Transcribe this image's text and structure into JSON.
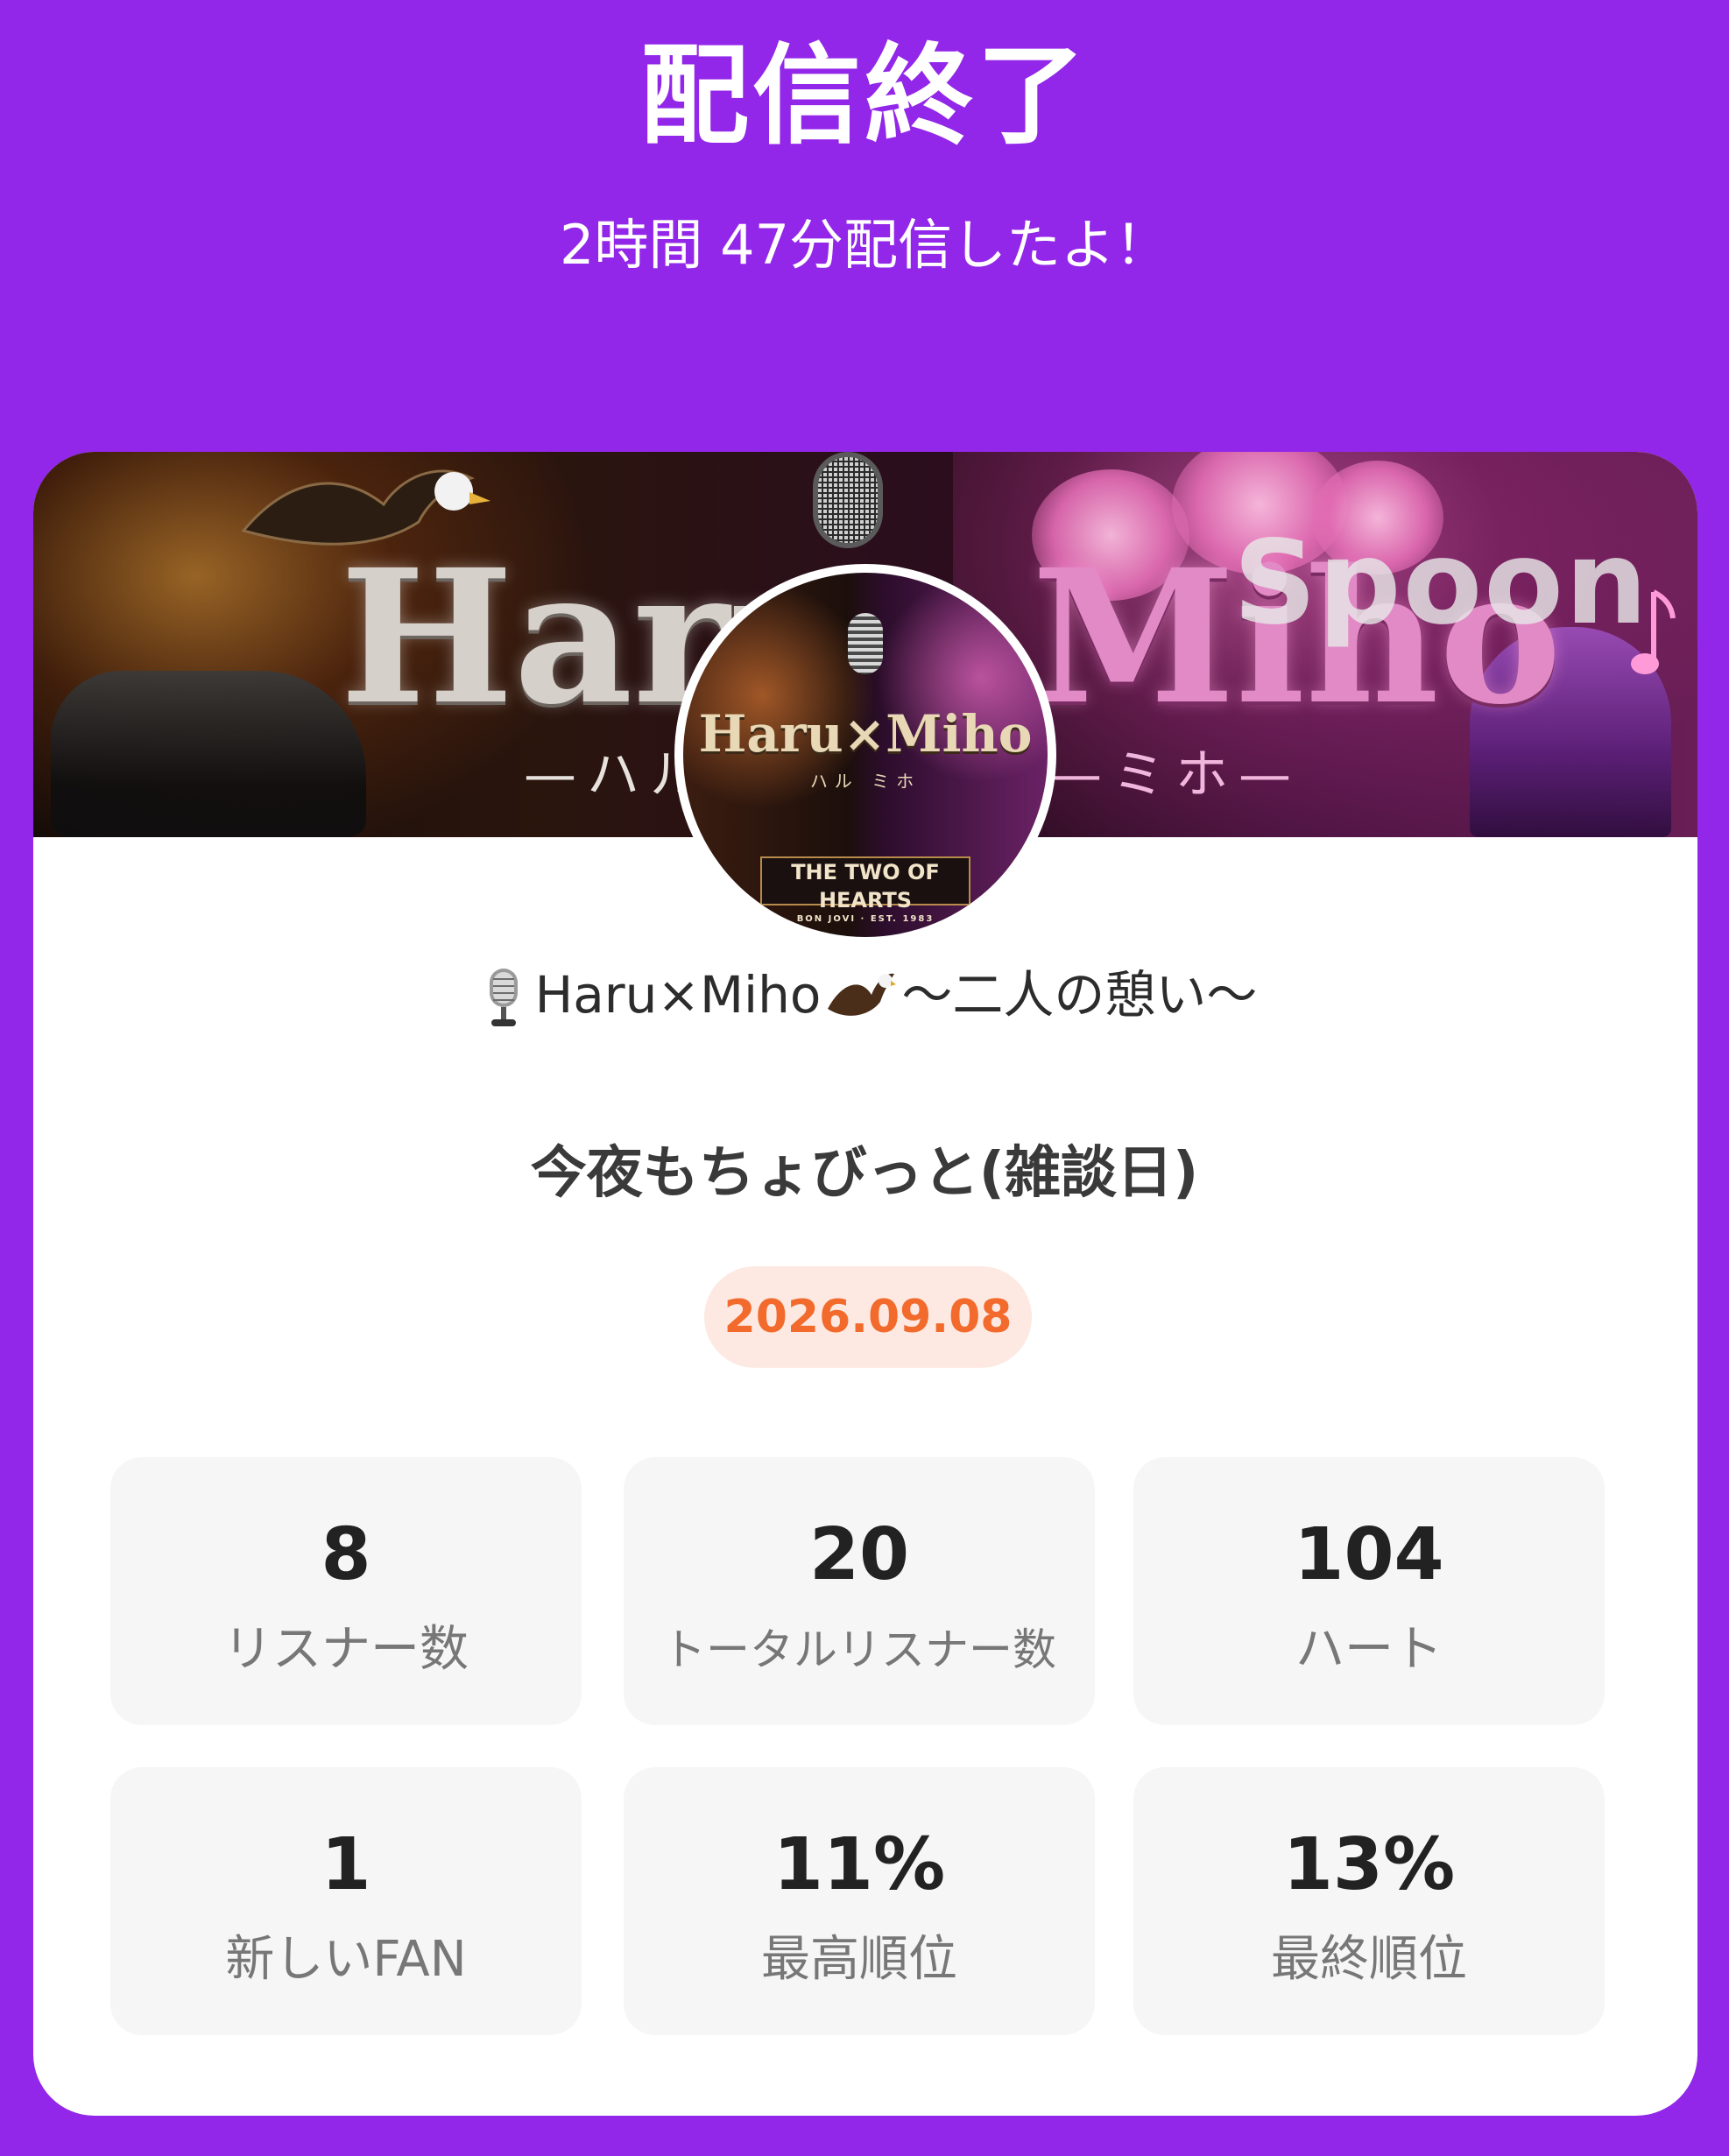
{
  "header": {
    "title": "配信終了",
    "subtitle": "2時間 47分配信したよ！"
  },
  "banner": {
    "title_left": "Haru",
    "title_right": "Miho",
    "sub_left": "—ハル—",
    "sub_right": "—ミホ—",
    "watermark": "Spoon"
  },
  "avatar": {
    "title": "Haru×Miho",
    "sub": "ハル    ミホ",
    "banner_main": "THE TWO OF HEARTS",
    "banner_small": "BON JOVI · EST. 1983"
  },
  "channel": {
    "name_part1": "Haru×Miho",
    "name_part2": "〜二人の憩い〜",
    "icons": [
      "microphone-icon",
      "eagle-icon"
    ]
  },
  "stream": {
    "title": "今夜もちょびっと(雑談日)",
    "date": "2026.09.08"
  },
  "stats": [
    {
      "value": "8",
      "label": "リスナー数"
    },
    {
      "value": "20",
      "label": "トータルリスナー数"
    },
    {
      "value": "104",
      "label": "ハート"
    },
    {
      "value": "1",
      "label": "新しいFAN"
    },
    {
      "value": "11%",
      "label": "最高順位"
    },
    {
      "value": "13%",
      "label": "最終順位"
    }
  ],
  "colors": {
    "background": "#9226e9",
    "card": "#ffffff",
    "date_text": "#f26a2c",
    "date_bg": "#fde9e2",
    "stat_bg": "#f6f6f6"
  }
}
